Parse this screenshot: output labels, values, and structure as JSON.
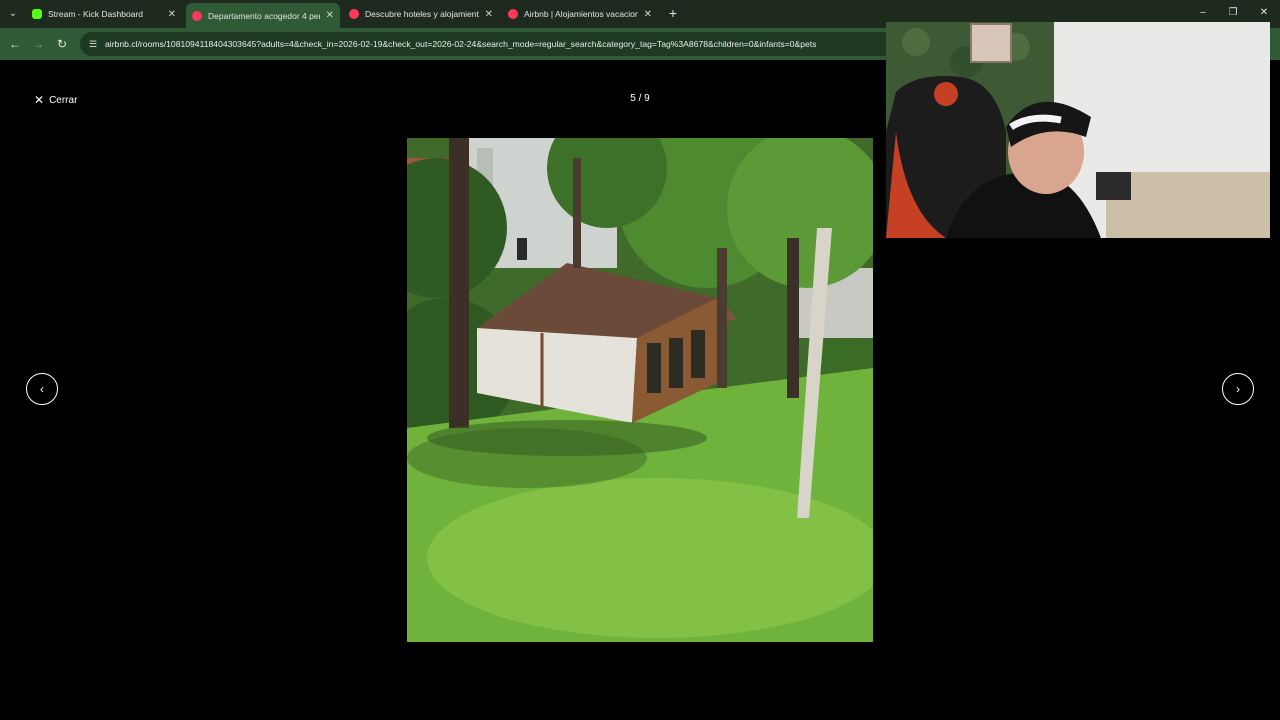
{
  "tabs": [
    {
      "title": "Stream - Kick Dashboard",
      "icon": "kick-icon",
      "active": false
    },
    {
      "title": "Departamento acogedor 4 pers",
      "icon": "airbnb-icon",
      "active": true
    },
    {
      "title": "Descubre hoteles y alojamiento",
      "icon": "airbnb-icon",
      "active": false
    },
    {
      "title": "Airbnb | Alojamientos vacacion",
      "icon": "airbnb-icon",
      "active": false
    }
  ],
  "address_bar": {
    "url": "airbnb.cl/rooms/1081094118404303645?adults=4&check_in=2026-02-19&check_out=2026-02-24&search_mode=regular_search&category_tag=Tag%3A8678&children=0&infants=0&pets"
  },
  "gallery": {
    "close_label": "Cerrar",
    "counter": "5 / 9",
    "prev_icon": "chevron-left-icon",
    "next_icon": "chevron-right-icon"
  },
  "colors": {
    "tabbar_bg": "#1f2a1f",
    "toolbar_bg": "#2f5a35",
    "kick_green": "#53fc18",
    "airbnb_red": "#ff385c"
  }
}
